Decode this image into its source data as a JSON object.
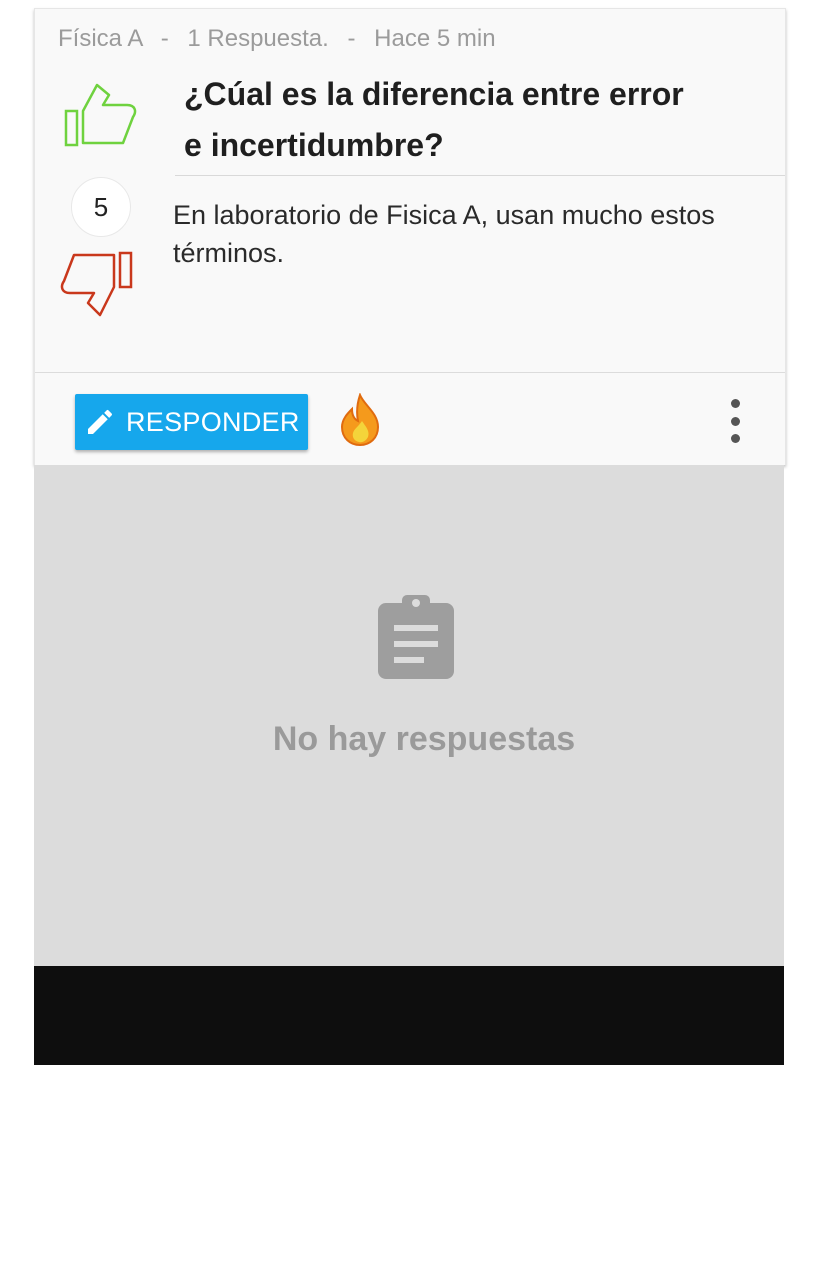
{
  "post": {
    "subject": "Física A",
    "separator": "-",
    "answers_count": "1 Respuesta.",
    "time_ago": "Hace 5 min",
    "title": "¿Cúal es la diferencia entre error e incertidumbre?",
    "score": "5",
    "body": "En laboratorio de Fisica A, usan mucho estos términos."
  },
  "actions": {
    "respond_label": "RESPONDER",
    "respond_icon": "pencil-icon",
    "hot_icon": "fire-icon",
    "more_icon": "more-vertical-icon"
  },
  "empty_state": {
    "icon": "clipboard-icon",
    "message": "No hay respuestas"
  },
  "colors": {
    "upvote": "#6fd23f",
    "downvote": "#c9381c",
    "accent": "#16a7ec",
    "fire_outer": "#f59a1c",
    "fire_inner": "#f4d43a"
  }
}
